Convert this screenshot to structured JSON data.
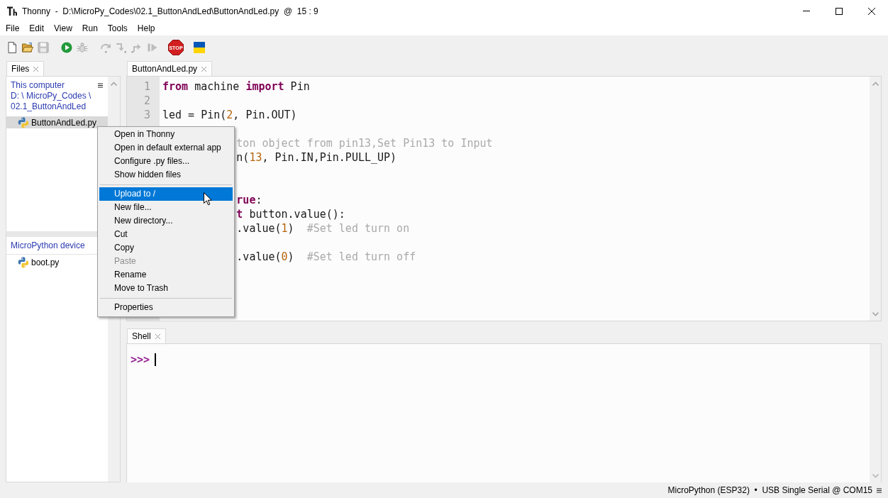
{
  "window": {
    "title": "Thonny  -  D:\\MicroPy_Codes\\02.1_ButtonAndLed\\ButtonAndLed.py  @  15 : 9"
  },
  "menu_bar": [
    "File",
    "Edit",
    "View",
    "Run",
    "Tools",
    "Help"
  ],
  "toolbar": {
    "groups": [
      {
        "buttons": [
          {
            "kind": "new",
            "disabled": false
          },
          {
            "kind": "open",
            "disabled": false
          },
          {
            "kind": "save",
            "disabled": true
          }
        ]
      },
      {
        "buttons": [
          {
            "kind": "run",
            "disabled": false
          },
          {
            "kind": "debug",
            "disabled": true
          }
        ]
      },
      {
        "buttons": [
          {
            "kind": "step_over",
            "disabled": true
          },
          {
            "kind": "step_into",
            "disabled": true
          },
          {
            "kind": "step_out",
            "disabled": true
          },
          {
            "kind": "resume",
            "disabled": true
          }
        ]
      },
      {
        "buttons": [
          {
            "kind": "stop",
            "label": "STOP",
            "disabled": false
          }
        ]
      },
      {
        "buttons": [
          {
            "kind": "flag",
            "disabled": false
          }
        ]
      }
    ]
  },
  "files_panel": {
    "tab": {
      "label": "Files",
      "selected": true
    },
    "sections": [
      {
        "heading": "This computer",
        "path": "D: \\ MicroPy_Codes \\ 02.1_ButtonAndLed",
        "items": [
          {
            "label": "ButtonAndLed.py",
            "selected": true
          }
        ]
      },
      {
        "heading": "MicroPython device",
        "items": [
          {
            "label": "boot.py",
            "selected": false
          }
        ]
      }
    ]
  },
  "editor": {
    "tab": {
      "label": "ButtonAndLed.py",
      "selected": true
    },
    "lines": [
      {
        "kind": "numbered",
        "number": "1",
        "tokens": [
          {
            "kind": "keyword",
            "text": "from"
          },
          {
            "kind": "plain",
            "text": " machine "
          },
          {
            "kind": "keyword",
            "text": "import"
          },
          {
            "kind": "plain",
            "text": " Pin"
          }
        ]
      },
      {
        "kind": "numbered",
        "number": "2"
      },
      {
        "kind": "numbered",
        "number": "3",
        "tokens": [
          {
            "kind": "plain",
            "text": "led = Pin("
          },
          {
            "kind": "number",
            "text": "2"
          },
          {
            "kind": "plain",
            "text": ", Pin.OUT)"
          }
        ]
      },
      {
        "kind": "covered"
      },
      {
        "kind": "covered",
        "tokens": [
          {
            "kind": "comment",
            "text": "ton object from pin13,Set Pin13 to Input"
          }
        ]
      },
      {
        "kind": "covered",
        "tokens": [
          {
            "kind": "plain",
            "text": "n("
          },
          {
            "kind": "number",
            "text": "13"
          },
          {
            "kind": "plain",
            "text": ", Pin.IN,Pin.PULL_UP)"
          }
        ]
      },
      {
        "kind": "covered"
      },
      {
        "kind": "covered"
      },
      {
        "kind": "covered",
        "tokens": [
          {
            "kind": "keyword",
            "text": "rue"
          },
          {
            "kind": "plain",
            "text": ":"
          }
        ]
      },
      {
        "kind": "covered",
        "tokens": [
          {
            "kind": "keyword",
            "text": "t"
          },
          {
            "kind": "plain",
            "text": " button.value():"
          }
        ]
      },
      {
        "kind": "covered",
        "tokens": [
          {
            "kind": "plain",
            "text": ".value("
          },
          {
            "kind": "number",
            "text": "1"
          },
          {
            "kind": "plain",
            "text": ")  "
          },
          {
            "kind": "comment",
            "text": "#Set led turn on"
          }
        ]
      },
      {
        "kind": "covered"
      },
      {
        "kind": "covered",
        "tokens": [
          {
            "kind": "plain",
            "text": ".value("
          },
          {
            "kind": "number",
            "text": "0"
          },
          {
            "kind": "plain",
            "text": ")  "
          },
          {
            "kind": "comment",
            "text": "#Set led turn off"
          }
        ]
      }
    ]
  },
  "shell": {
    "tab": {
      "label": "Shell",
      "selected": true
    },
    "prompt": ">>>"
  },
  "status_bar": {
    "text": "MicroPython (ESP32)  •  USB Single Serial @ COM15"
  },
  "context_menu": {
    "items": [
      {
        "kind": "item",
        "label": "Open in Thonny",
        "selected": false,
        "disabled": false
      },
      {
        "kind": "item",
        "label": "Open in default external app",
        "selected": false,
        "disabled": false
      },
      {
        "kind": "item",
        "label": "Configure .py files...",
        "selected": false,
        "disabled": false
      },
      {
        "kind": "item",
        "label": "Show hidden files",
        "selected": false,
        "disabled": false
      },
      {
        "kind": "separator"
      },
      {
        "kind": "item",
        "label": "Upload to /",
        "selected": true,
        "disabled": false
      },
      {
        "kind": "item",
        "label": "New file...",
        "selected": false,
        "disabled": false
      },
      {
        "kind": "item",
        "label": "New directory...",
        "selected": false,
        "disabled": false
      },
      {
        "kind": "item",
        "label": "Cut",
        "selected": false,
        "disabled": false
      },
      {
        "kind": "item",
        "label": "Copy",
        "selected": false,
        "disabled": false
      },
      {
        "kind": "item",
        "label": "Paste",
        "selected": false,
        "disabled": true
      },
      {
        "kind": "item",
        "label": "Rename",
        "selected": false,
        "disabled": false
      },
      {
        "kind": "item",
        "label": "Move to Trash",
        "selected": false,
        "disabled": false
      },
      {
        "kind": "separator"
      },
      {
        "kind": "item",
        "label": "Properties",
        "selected": false,
        "disabled": false
      }
    ]
  }
}
